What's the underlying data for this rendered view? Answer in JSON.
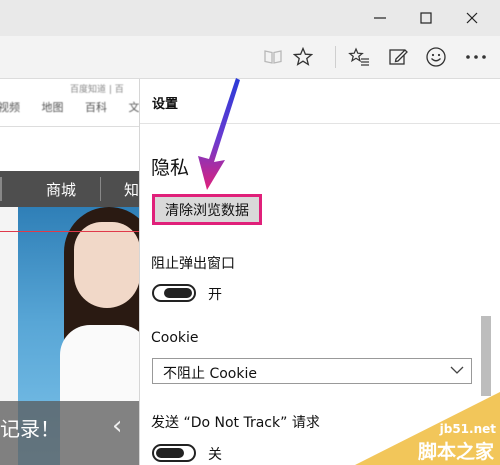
{
  "window": {
    "controls": [
      "minimize-icon",
      "maximize-icon",
      "close-icon"
    ]
  },
  "toolbar": {
    "icons": [
      "reading-view-icon",
      "star-icon",
      "favorites-hub-icon",
      "web-note-icon",
      "feedback-smiley-icon",
      "more-icon"
    ]
  },
  "background_page": {
    "top_links": "百度知道 | 百",
    "nav_small": [
      "视频",
      "地图",
      "百科",
      "文"
    ],
    "nav_bar": [
      "商城",
      "知"
    ],
    "banner_caption": "记录！",
    "banner_arrow": "‹"
  },
  "settings": {
    "header_title": "设置",
    "privacy_title": "隐私",
    "clear_button": "清除浏览数据",
    "popup_label": "阻止弹出窗口",
    "popup_state": "开",
    "popup_on": true,
    "cookie_label": "Cookie",
    "cookie_value": "不阻止 Cookie",
    "dnt_label": "发送 “Do Not Track” 请求",
    "dnt_state": "关",
    "dnt_on": false
  },
  "watermark": {
    "site": "jb51.net",
    "name": "脚本之家"
  },
  "colors": {
    "highlight_border": "#e0207a",
    "arrow": "#2a3bd8",
    "red_line": "#e03a4a"
  }
}
